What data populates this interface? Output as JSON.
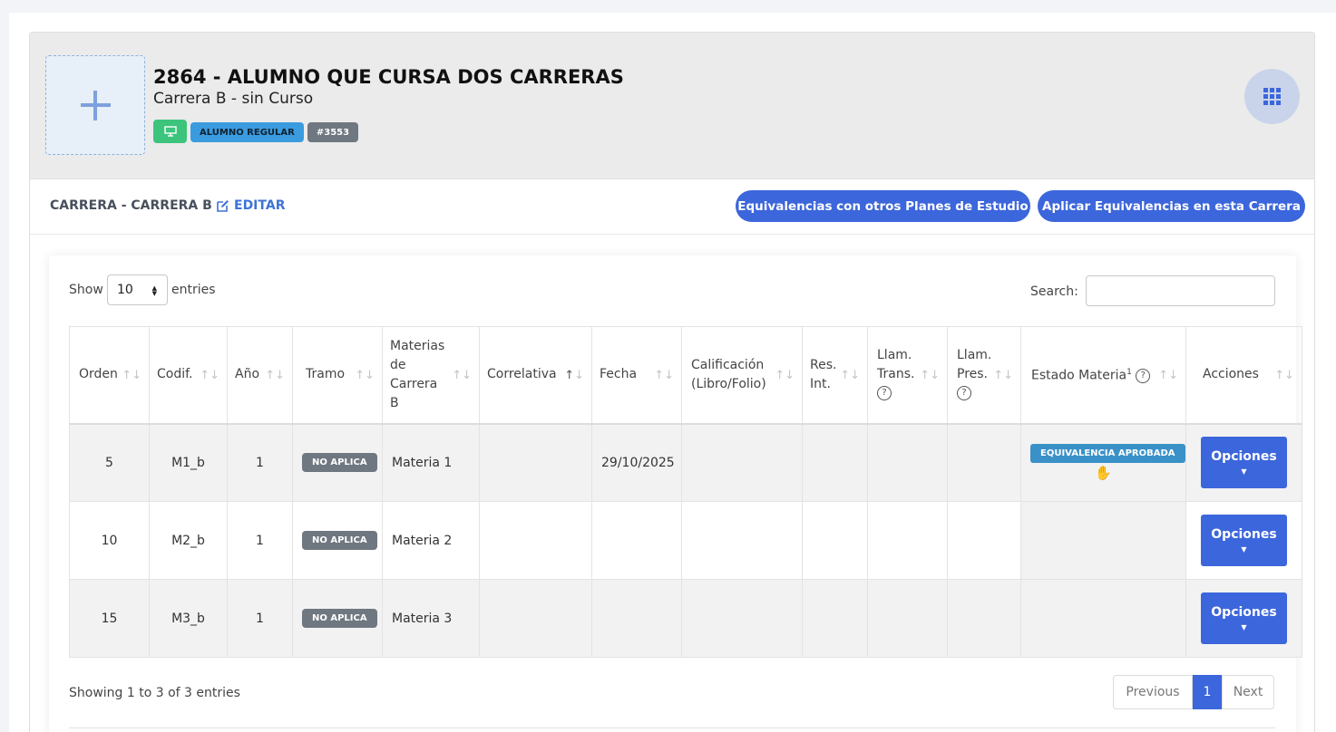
{
  "header": {
    "title": "2864 - ALUMNO QUE CURSA DOS CARRERAS",
    "subtitle": "Carrera B - sin Curso",
    "badge_status": "ALUMNO REGULAR",
    "badge_id": "#3553"
  },
  "toolbar": {
    "carrera_label": "CARRERA - CARRERA B",
    "edit_label": "EDITAR",
    "equiv_other_label": "Equivalencias con otros Planes de Estudio",
    "equiv_apply_label": "Aplicar Equivalencias en esta Carrera"
  },
  "table_controls": {
    "show_label": "Show",
    "entries_value": "10",
    "entries_label": "entries",
    "search_label": "Search:",
    "search_value": ""
  },
  "columns": {
    "orden": "Orden",
    "codif": "Codif.",
    "anio": "Año",
    "tramo": "Tramo",
    "materias_l1": "Materias",
    "materias_l2": "de",
    "materias_l3": "Carrera",
    "materias_l4": "B",
    "correlativa": "Correlativa",
    "fecha": "Fecha",
    "calif_l1": "Calificación",
    "calif_l2": "(Libro/Folio)",
    "res_l1": "Res.",
    "res_l2": "Int.",
    "ltrans_l1": "Llam.",
    "ltrans_l2": "Trans.",
    "lpres_l1": "Llam.",
    "lpres_l2": "Pres.",
    "estado": "Estado Materia",
    "estado_sup": "1",
    "acciones": "Acciones",
    "help": "?"
  },
  "rows": [
    {
      "orden": "5",
      "codif": "M1_b",
      "anio": "1",
      "tramo": "NO APLICA",
      "materia": "Materia 1",
      "correlativa": "",
      "fecha": "29/10/2025",
      "calificacion": "",
      "res": "",
      "ltrans": "",
      "lpres": "",
      "estado": "EQUIVALENCIA APROBADA",
      "accion": "Opciones"
    },
    {
      "orden": "10",
      "codif": "M2_b",
      "anio": "1",
      "tramo": "NO APLICA",
      "materia": "Materia 2",
      "correlativa": "",
      "fecha": "",
      "calificacion": "",
      "res": "",
      "ltrans": "",
      "lpres": "",
      "estado": "",
      "accion": "Opciones"
    },
    {
      "orden": "15",
      "codif": "M3_b",
      "anio": "1",
      "tramo": "NO APLICA",
      "materia": "Materia 3",
      "correlativa": "",
      "fecha": "",
      "calificacion": "",
      "res": "",
      "ltrans": "",
      "lpres": "",
      "estado": "",
      "accion": "Opciones"
    }
  ],
  "footer": {
    "showing": "Showing 1 to 3 of 3 entries",
    "previous": "Previous",
    "page": "1",
    "next": "Next"
  },
  "colors": {
    "primary": "#3c66db",
    "success": "#3cc47c",
    "info": "#3a91c8",
    "secondary": "#6f7780"
  },
  "icons": {
    "avatar": "plus-icon",
    "monitor": "monitor-icon",
    "grid": "grid-icon",
    "edit": "edit-icon",
    "hand": "hand-icon",
    "sort": "sort-arrows-icon",
    "caret": "caret-down-icon"
  }
}
